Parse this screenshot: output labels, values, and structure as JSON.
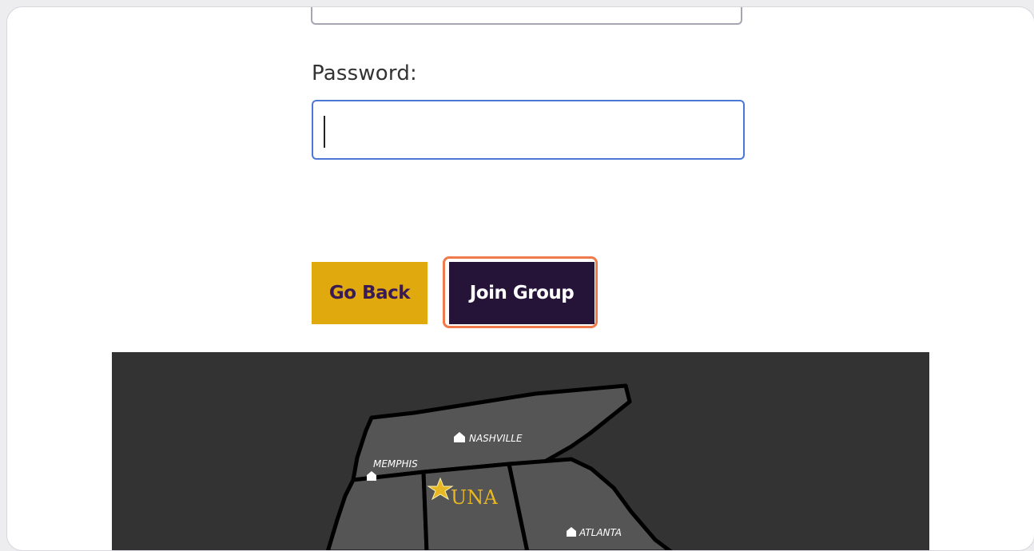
{
  "form": {
    "password_label": "Password:",
    "password_value": ""
  },
  "buttons": {
    "go_back_label": "Go Back",
    "join_group_label": "Join Group"
  },
  "map": {
    "cities": [
      "NASHVILLE",
      "MEMPHIS",
      "ATLANTA"
    ],
    "marker_label": "UNA",
    "marker_icon": "star-icon",
    "city_icon": "house-icon"
  },
  "colors": {
    "go_back_bg": "#e0aa0f",
    "join_group_bg": "#261338",
    "focus_ring": "#ef7a4a",
    "input_focus_border": "#4d77d6",
    "map_bg": "#333333",
    "region_fill": "#555555",
    "una_gold": "#e8b824"
  }
}
